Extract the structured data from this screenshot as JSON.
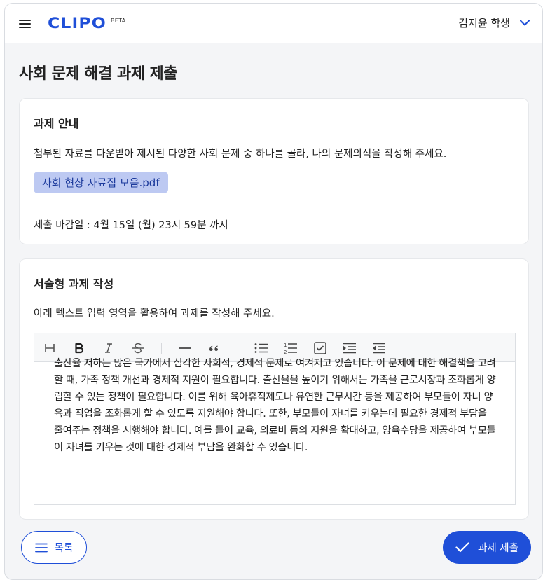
{
  "header": {
    "logo_text": "CLIPO",
    "logo_badge": "BETA",
    "user_name": "김지윤 학생"
  },
  "page": {
    "title": "사회 문제 해결 과제 제출"
  },
  "assignment_info": {
    "heading": "과제 안내",
    "description": "첨부된 자료를 다운받아 제시된 다양한 사회 문제 중 하나를 골라, 나의 문제의식을 작성해 주세요.",
    "attachment_name": "사회 현상 자료집 모음.pdf",
    "deadline": "제출 마감일 : 4월 15일 (월) 23시 59분 까지"
  },
  "essay": {
    "heading": "서술형 과제 작성",
    "instruction": "아래 텍스트 입력 영역을 활용하여 과제를 작성해 주세요.",
    "toolbar": [
      "heading-icon",
      "bold-icon",
      "italic-icon",
      "strikethrough-icon",
      "horizontal-rule-icon",
      "quote-icon",
      "bullet-list-icon",
      "ordered-list-icon",
      "checklist-icon",
      "indent-icon",
      "outdent-icon"
    ],
    "content": "출산율 저하는 많은 국가에서 심각한 사회적, 경제적 문제로 여겨지고 있습니다. 이 문제에 대한 해결책을 고려할 때, 가족 정책 개선과 경제적 지원이 필요합니다. 출산율을 높이기 위해서는 가족을 근로시장과 조화롭게 양립할 수 있는 정책이 필요합니다. 이를 위해 육아휴직제도나 유연한 근무시간 등을 제공하여 부모들이 자녀 양육과 직업을 조화롭게 할 수 있도록 지원해야 합니다. 또한, 부모들이 자녀를 키우는데 필요한 경제적 부담을 줄여주는 정책을 시행해야 합니다. 예를 들어 교육, 의료비 등의 지원을 확대하고, 양육수당을 제공하여 부모들이 자녀를 키우는 것에 대한 경제적 부담을 완화할 수 있습니다."
  },
  "footer": {
    "list_label": "목록",
    "submit_label": "과제 제출"
  },
  "colors": {
    "brand": "#1f4fd8",
    "chip_bg": "#bdc9f2",
    "page_bg": "#f4f5f7"
  }
}
